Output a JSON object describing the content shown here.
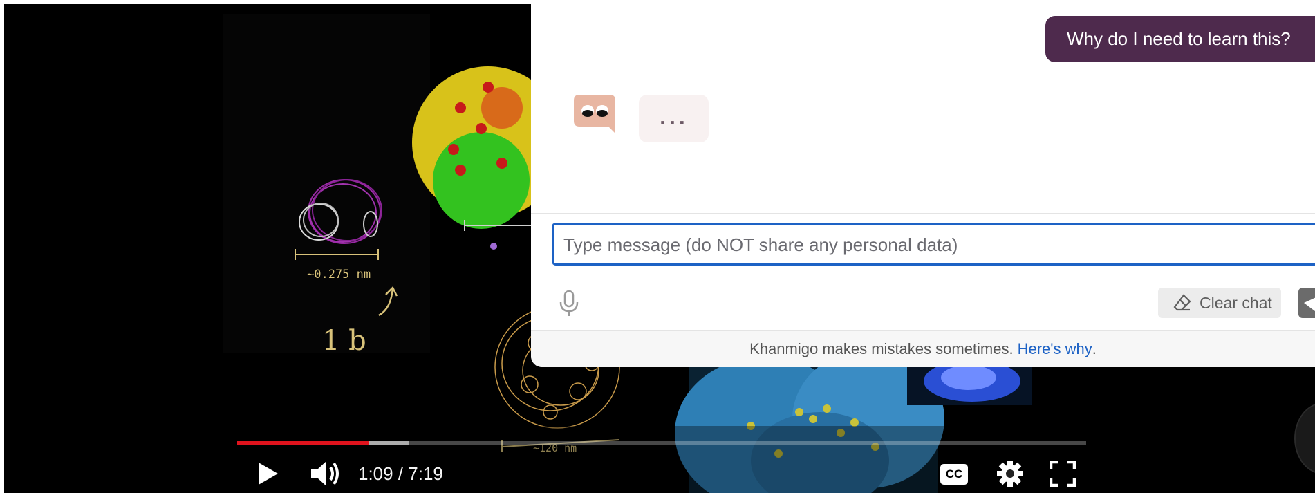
{
  "video": {
    "time_display": "1:09 / 7:19",
    "progress_played_fraction": 0.155,
    "progress_buffered_fraction": 0.203,
    "annotations": {
      "measure_small": "~0.275 nm",
      "measure_large": "~120 nm",
      "handwritten": "1 b"
    },
    "controls": {
      "play_icon": "play-icon",
      "volume_icon": "volume-icon",
      "cc_icon": "cc-icon",
      "cc_label": "CC",
      "settings_icon": "gear-icon",
      "fullscreen_icon": "fullscreen-icon"
    },
    "colors": {
      "played": "#e0131d"
    }
  },
  "chat": {
    "user_message": "Why do I need to learn this?",
    "typing_indicator": "...",
    "input_placeholder": "Type message (do NOT share any personal data)",
    "clear_label": "Clear chat",
    "footer_text": "Khanmigo makes mistakes sometimes.",
    "footer_link": "Here's why",
    "footer_period": ".",
    "colors": {
      "user_bubble": "#4e2a4d",
      "accent": "#1d62c5"
    }
  }
}
